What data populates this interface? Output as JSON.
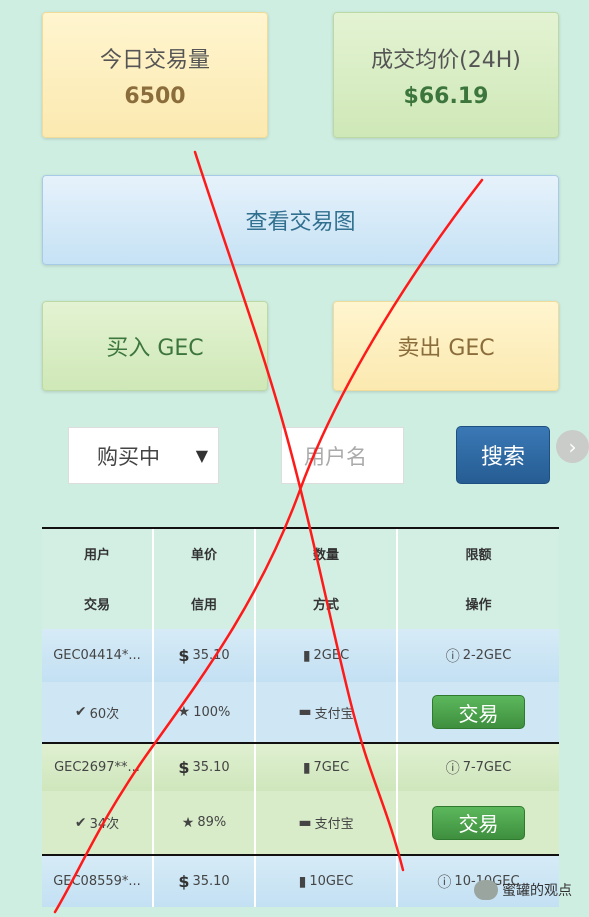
{
  "stats": {
    "volume": {
      "label": "今日交易量",
      "value": "6500"
    },
    "avg_price": {
      "label": "成交均价(24H)",
      "value": "$66.19"
    }
  },
  "buttons": {
    "view_chart": "查看交易图",
    "buy": "买入 GEC",
    "sell": "卖出 GEC",
    "search": "搜索"
  },
  "filter": {
    "select_value": "购买中",
    "username_placeholder": "用户名"
  },
  "table": {
    "header_row1": [
      "用户",
      "单价",
      "数量",
      "限额"
    ],
    "header_row2": [
      "交易",
      "信用",
      "方式",
      "操作"
    ],
    "orders": [
      {
        "user": "GEC04414*...",
        "price": "35.10",
        "quantity": "2GEC",
        "limit": "2-2GEC",
        "trades": "60次",
        "credit": "100%",
        "method": "支付宝",
        "action": "交易"
      },
      {
        "user": "GEC2697**...",
        "price": "35.10",
        "quantity": "7GEC",
        "limit": "7-7GEC",
        "trades": "34次",
        "credit": "89%",
        "method": "支付宝",
        "action": "交易"
      },
      {
        "user": "GEC08559*...",
        "price": "35.10",
        "quantity": "10GEC",
        "limit": "10-10GEC"
      }
    ]
  },
  "watermark": {
    "text": "蜜罐的观点"
  },
  "icons": {
    "price": "dollar-icon",
    "quantity": "bar-chart-icon",
    "limit": "info-icon",
    "trades": "check-circle-icon",
    "credit": "star-icon",
    "method": "credit-card-icon"
  },
  "colors": {
    "background": "#cfeee2",
    "search_button": "#2a6399",
    "trade_button": "#4cae4c",
    "annotation": "#ff1a1a"
  }
}
